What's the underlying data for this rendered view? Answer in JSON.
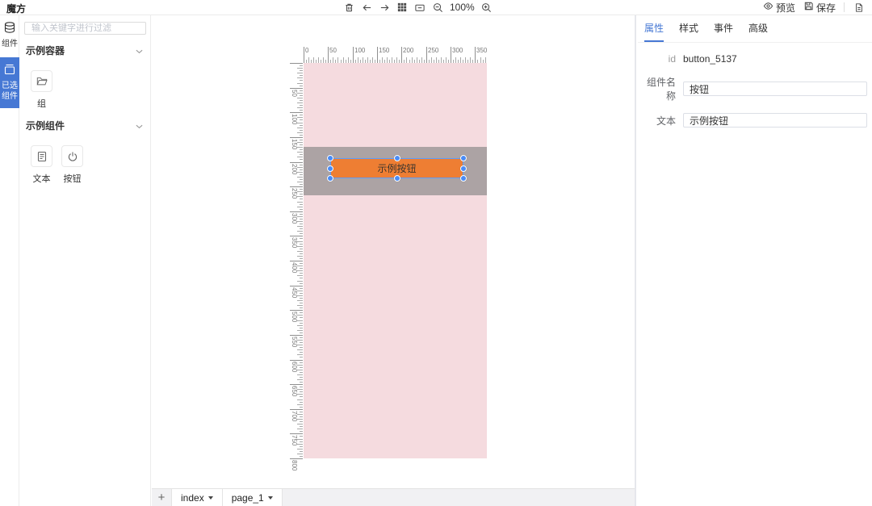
{
  "app": {
    "title": "魔方"
  },
  "topbar": {
    "zoom_level": "100%",
    "preview_label": "预览",
    "save_label": "保存",
    "tool_icons": [
      "trash-icon",
      "undo-icon",
      "redo-icon",
      "grid-icon",
      "screen-icon",
      "zoom-out-icon",
      "zoom-in-icon",
      "preview-icon",
      "save-icon",
      "document-icon"
    ]
  },
  "left_rail": {
    "tabs": [
      {
        "label": "组件",
        "icon": "components-icon",
        "lines": [
          "组件"
        ]
      },
      {
        "label": "已选组件",
        "icon": "selected-components-icon",
        "lines": [
          "已选",
          "组件"
        ]
      }
    ]
  },
  "components_panel": {
    "search_placeholder": "输入关键字进行过滤",
    "sections": [
      {
        "title": "示例容器",
        "items": [
          {
            "label": "组",
            "icon": "folder-icon"
          }
        ]
      },
      {
        "title": "示例组件",
        "items": [
          {
            "label": "文本",
            "icon": "text-file-icon"
          },
          {
            "label": "按钮",
            "icon": "power-icon"
          }
        ]
      }
    ]
  },
  "canvas": {
    "rulers": {
      "h_labels": [
        "0",
        "50",
        "100",
        "150",
        "200",
        "250",
        "300",
        "350"
      ],
      "v_labels": [
        "50",
        "100",
        "150",
        "200",
        "250",
        "300",
        "350",
        "400",
        "450",
        "500",
        "550",
        "600",
        "650",
        "700",
        "750",
        "800"
      ]
    },
    "button": {
      "label": "示例按钮"
    },
    "colors": {
      "page_bg": "#f5dbdf",
      "group_band_bg": "#aca3a4",
      "button_bg": "#ee7e33",
      "selection_blue": "#4a8cf7"
    }
  },
  "pages_bar": {
    "add_label": "+",
    "tabs": [
      {
        "name": "index"
      },
      {
        "name": "page_1"
      }
    ]
  },
  "inspector": {
    "tabs": [
      "属性",
      "样式",
      "事件",
      "高级"
    ],
    "active_tab": "属性",
    "accent_color": "#4678d4",
    "fields": {
      "id_label": "id",
      "id_value": "button_5137",
      "name_label": "组件名称",
      "name_value": "按钮",
      "text_label": "文本",
      "text_value": "示例按钮"
    }
  }
}
